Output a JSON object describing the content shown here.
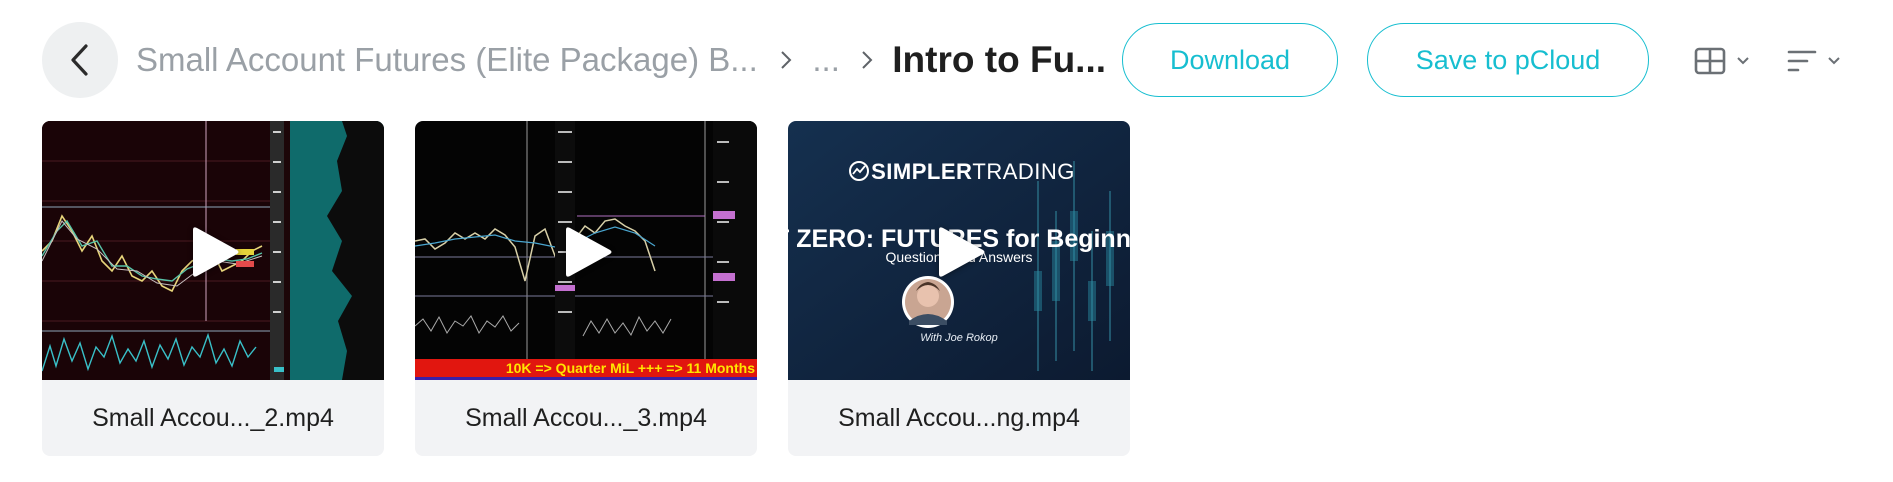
{
  "breadcrumb": {
    "root": "Small Account Futures (Elite Package) B...",
    "ellipsis": "...",
    "current": "Intro to Fu..."
  },
  "actions": {
    "download_label": "Download",
    "save_label": "Save to pCloud"
  },
  "icons": {
    "back": "arrow-left-icon",
    "separator": "chevron-right-icon",
    "grid_view": "grid-view-icon",
    "sort": "sort-icon",
    "dropdown": "chevron-down-icon",
    "play": "play-icon"
  },
  "files": [
    {
      "name": "Small Accou..._2.mp4",
      "type": "video"
    },
    {
      "name": "Small Accou..._3.mp4",
      "type": "video"
    },
    {
      "name": "Small Accou...ng.mp4",
      "type": "video"
    }
  ],
  "thumbnails": {
    "third": {
      "brand_bold": "SIMPLER",
      "brand_light": "TRADING",
      "title": "RT ZERO: FUTURES for Beginne",
      "subtitle": "Questions and Answers",
      "host": "With Joe Rokop"
    },
    "second": {
      "banner": "10K => Quarter MiL +++ => 11 Months"
    }
  },
  "colors": {
    "accent": "#17bed0",
    "muted_text": "#9aa0a6",
    "card_bg": "#f2f3f5",
    "back_bg": "#eef0f1"
  }
}
